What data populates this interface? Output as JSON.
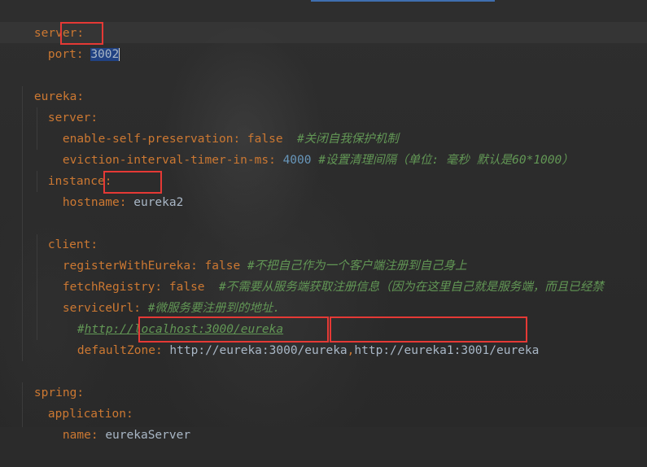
{
  "editor": {
    "lines": {
      "l1_key": "server",
      "l2_key": "port",
      "l2_val": "3002",
      "l4_key": "eureka",
      "l5_key": "server",
      "l6_key": "enable-self-preservation",
      "l6_val": "false",
      "l6_comment": "#关闭自我保护机制",
      "l7_key": "eviction-interval-timer-in-ms",
      "l7_val": "4000",
      "l7_comment": "#设置清理间隔（单位: 毫秒 默认是60*1000）",
      "l8_key": "instance",
      "l9_key": "hostname",
      "l9_val": "eureka2",
      "l11_key": "client",
      "l12_key": "registerWithEureka",
      "l12_val": "false",
      "l12_comment": "#不把自己作为一个客户端注册到自己身上",
      "l13_key": "fetchRegistry",
      "l13_val": "false",
      "l13_comment": "#不需要从服务端获取注册信息（因为在这里自己就是服务端，而且已经禁",
      "l14_key": "serviceUrl",
      "l14_comment": "#微服务要注册到的地址.",
      "l15_comment_prefix": "#",
      "l15_url": "http://localhost:3000/eureka",
      "l16_key": "defaultZone",
      "l16_val1": "http://eureka:3000/eureka",
      "l16_sep": ",",
      "l16_val2": "http://eureka1:3001/eureka",
      "l18_key": "spring",
      "l19_key": "application",
      "l20_key": "name",
      "l20_val": "eurekaServer"
    },
    "colon": ":",
    "colors": {
      "key": "#cc7832",
      "string": "#a9b7c6",
      "number": "#6897bb",
      "comment": "#629755",
      "highlight_box": "#e53935"
    }
  }
}
